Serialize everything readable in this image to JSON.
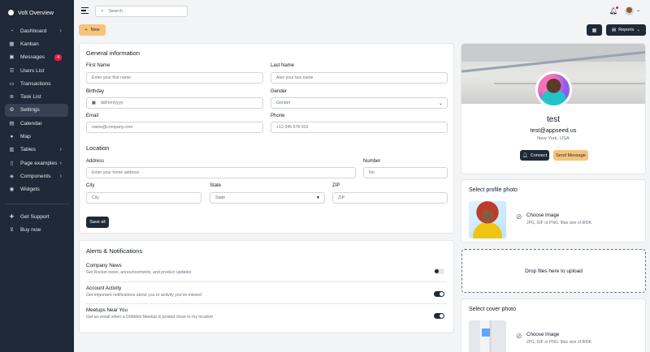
{
  "sidebar": {
    "brand": "Volt Overview",
    "items": [
      {
        "label": "Dashboard",
        "icon": "pie-chart-icon",
        "chevron": true
      },
      {
        "label": "Kanban",
        "icon": "grid-icon"
      },
      {
        "label": "Messages",
        "icon": "inbox-icon",
        "badge": "4"
      },
      {
        "label": "Users List",
        "icon": "users-icon"
      },
      {
        "label": "Transactions",
        "icon": "credit-card-icon"
      },
      {
        "label": "Task List",
        "icon": "list-icon"
      },
      {
        "label": "Settings",
        "icon": "gear-icon",
        "active": true
      },
      {
        "label": "Calendar",
        "icon": "calendar-icon"
      },
      {
        "label": "Map",
        "icon": "location-icon"
      },
      {
        "label": "Tables",
        "icon": "table-icon",
        "chevron": true
      },
      {
        "label": "Page examples",
        "icon": "file-icon",
        "chevron": true
      },
      {
        "label": "Components",
        "icon": "puzzle-icon",
        "chevron": true
      },
      {
        "label": "Widgets",
        "icon": "widgets-icon"
      }
    ],
    "footer_items": [
      {
        "label": "Get Support",
        "icon": "support-icon"
      },
      {
        "label": "Buy now",
        "icon": "cart-icon"
      }
    ]
  },
  "topbar": {
    "search_placeholder": "Search"
  },
  "actions": {
    "new_label": "New",
    "reports_label": "Reports"
  },
  "general": {
    "title": "General information",
    "first_name_label": "First Name",
    "first_name_placeholder": "Enter your first name",
    "last_name_label": "Last Name",
    "last_name_placeholder": "Also your last name",
    "birthday_label": "Birthday",
    "birthday_placeholder": "dd/mm/yyyy",
    "gender_label": "Gender",
    "gender_value": "Gender",
    "email_label": "Email",
    "email_placeholder": "name@company.com",
    "phone_label": "Phone",
    "phone_placeholder": "+12-345 678 910",
    "location_title": "Location",
    "address_label": "Address",
    "address_placeholder": "Enter your home address",
    "number_label": "Number",
    "number_placeholder": "No.",
    "city_label": "City",
    "city_placeholder": "City",
    "state_label": "State",
    "state_value": "State",
    "zip_label": "ZIP",
    "zip_placeholder": "ZIP",
    "save_label": "Save all"
  },
  "notifications": {
    "title": "Alerts & Notifications",
    "items": [
      {
        "title": "Company News",
        "desc": "Get Rocket news, announcements, and product updates",
        "on": false
      },
      {
        "title": "Account Activity",
        "desc": "Get important notifications about you or activity you've missed",
        "on": true
      },
      {
        "title": "Meetups Near You",
        "desc": "Get an email when a Dribbble Meetup is posted close to my location",
        "on": true
      }
    ]
  },
  "profile": {
    "name": "test",
    "email": "test@appseed.us",
    "location": "New York, USA",
    "connect_label": "Connect",
    "message_label": "Send Message"
  },
  "profile_photo": {
    "title": "Select profile photo",
    "choose_label": "Choose Image",
    "hint": "JPG, GIF or PNG. Max size of 800K"
  },
  "dropzone": {
    "text": "Drop files here to upload"
  },
  "cover_photo": {
    "title": "Select cover photo",
    "choose_label": "Choose Image",
    "hint": "JPG, GIF or PNG. Max size of 800K"
  }
}
